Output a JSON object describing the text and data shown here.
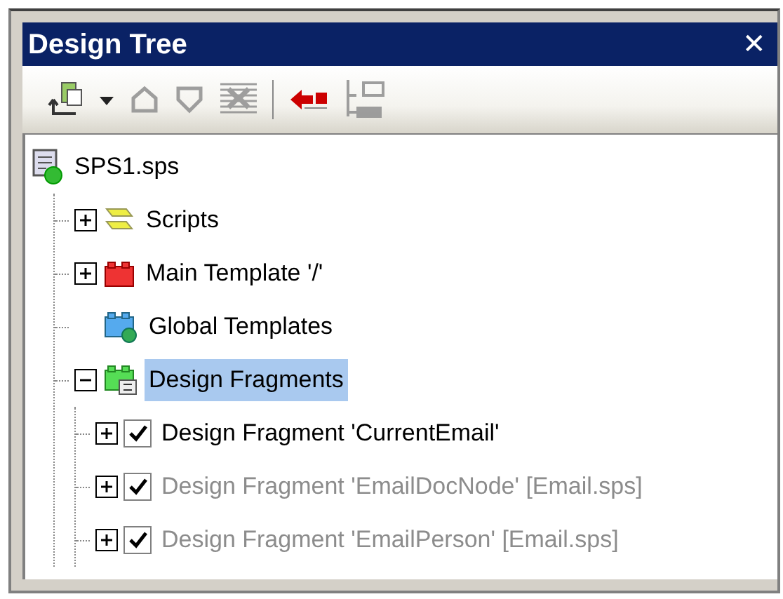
{
  "window": {
    "title": "Design Tree",
    "close": "✕"
  },
  "toolbar": [
    {
      "kind": "add",
      "disabled": false
    },
    {
      "kind": "dropdown",
      "disabled": false
    },
    {
      "kind": "up",
      "disabled": true
    },
    {
      "kind": "down",
      "disabled": true
    },
    {
      "kind": "remove",
      "disabled": true
    },
    {
      "kind": "separator"
    },
    {
      "kind": "import",
      "disabled": false
    },
    {
      "kind": "tree",
      "disabled": true
    }
  ],
  "tree": {
    "label": "SPS1.sps",
    "kind": "sps",
    "children": [
      {
        "label": "Scripts",
        "kind": "scripts",
        "expanded": false,
        "selected": false
      },
      {
        "label": "Main Template '/'",
        "kind": "main",
        "expanded": false,
        "selected": false
      },
      {
        "label": "Global Templates",
        "kind": "global",
        "selected": false
      },
      {
        "label": "Design Fragments",
        "kind": "fragments",
        "expanded": true,
        "selected": true,
        "children": [
          {
            "label": "Design Fragment 'CurrentEmail'",
            "expanded": false,
            "checked": true,
            "dimmed": false
          },
          {
            "label": "Design Fragment 'EmailDocNode' [Email.sps]",
            "expanded": false,
            "checked": true,
            "dimmed": true
          },
          {
            "label": "Design Fragment 'EmailPerson' [Email.sps]",
            "expanded": false,
            "checked": true,
            "dimmed": true
          }
        ]
      }
    ]
  }
}
